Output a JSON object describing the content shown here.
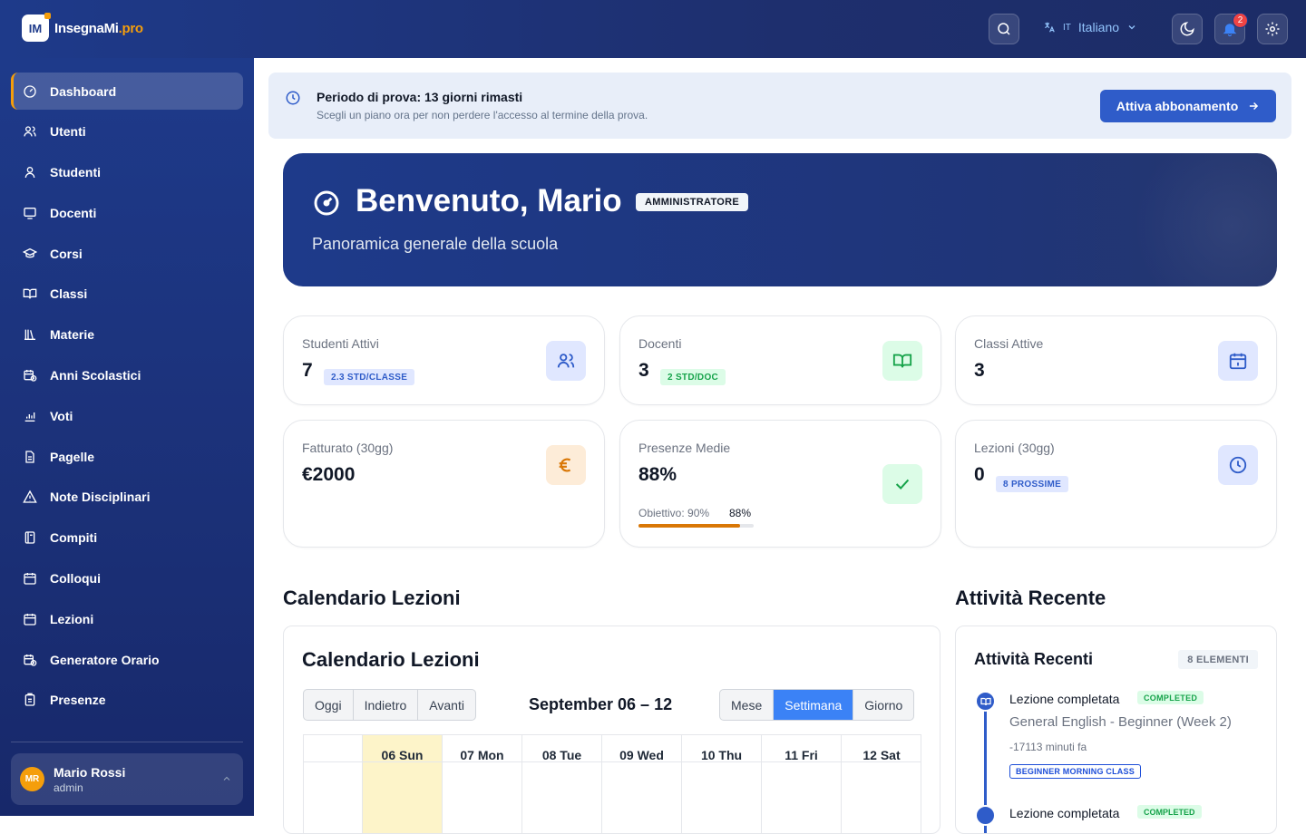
{
  "brand": {
    "name": "InsegnaMi",
    "suffix": ".pro",
    "mark": "IM"
  },
  "topbar": {
    "language_code": "IT",
    "language": "Italiano",
    "notifications": "2"
  },
  "sidebar": {
    "items": [
      {
        "label": "Dashboard",
        "icon": "gauge-icon"
      },
      {
        "label": "Utenti",
        "icon": "users-icon"
      },
      {
        "label": "Studenti",
        "icon": "user-icon"
      },
      {
        "label": "Docenti",
        "icon": "monitor-icon"
      },
      {
        "label": "Corsi",
        "icon": "graduation-cap-icon"
      },
      {
        "label": "Classi",
        "icon": "book-open-icon"
      },
      {
        "label": "Materie",
        "icon": "library-icon"
      },
      {
        "label": "Anni Scolastici",
        "icon": "calendar-clock-icon"
      },
      {
        "label": "Voti",
        "icon": "chart-icon"
      },
      {
        "label": "Pagelle",
        "icon": "file-icon"
      },
      {
        "label": "Note Disciplinari",
        "icon": "warning-icon"
      },
      {
        "label": "Compiti",
        "icon": "notebook-icon"
      },
      {
        "label": "Colloqui",
        "icon": "calendar-icon"
      },
      {
        "label": "Lezioni",
        "icon": "calendar-icon"
      },
      {
        "label": "Generatore Orario",
        "icon": "calendar-clock-icon"
      },
      {
        "label": "Presenze",
        "icon": "clipboard-icon"
      }
    ],
    "user": {
      "initials": "MR",
      "name": "Mario Rossi",
      "role": "admin"
    }
  },
  "trial": {
    "title": "Periodo di prova: 13 giorni rimasti",
    "subtitle": "Scegli un piano ora per non perdere l'accesso al termine della prova.",
    "button": "Attiva abbonamento"
  },
  "hero": {
    "title": "Benvenuto, Mario",
    "badge": "AMMINISTRATORE",
    "subtitle": "Panoramica generale della scuola"
  },
  "stats": [
    {
      "label": "Studenti Attivi",
      "value": "7",
      "badge": "2.3 STD/CLASSE"
    },
    {
      "label": "Docenti",
      "value": "3",
      "badge": "2 STD/DOC"
    },
    {
      "label": "Classi Attive",
      "value": "3"
    },
    {
      "label": "Fatturato (30gg)",
      "value": "€2000"
    },
    {
      "label": "Presenze Medie",
      "value": "88%",
      "progress_label": "Obiettivo: 90%",
      "progress_value": "88%",
      "progress_fraction": 0.88
    },
    {
      "label": "Lezioni (30gg)",
      "value": "0",
      "badge": "8 PROSSIME"
    }
  ],
  "calendar": {
    "section_title": "Calendario Lezioni",
    "title": "Calendario Lezioni",
    "nav": [
      "Oggi",
      "Indietro",
      "Avanti"
    ],
    "range": "September 06 – 12",
    "views": [
      "Mese",
      "Settimana",
      "Giorno"
    ],
    "active_view": "Settimana",
    "days": [
      "06 Sun",
      "07 Mon",
      "08 Tue",
      "09 Wed",
      "10 Thu",
      "11 Fri",
      "12 Sat"
    ]
  },
  "activity": {
    "section_title": "Attività Recente",
    "title": "Attività Recenti",
    "count": "8 ELEMENTI",
    "items": [
      {
        "title": "Lezione completata",
        "status": "COMPLETED",
        "subtitle": "General English - Beginner (Week 2)",
        "time": "-17113 minuti fa",
        "tag": "BEGINNER MORNING CLASS"
      },
      {
        "title": "Lezione completata",
        "status": "COMPLETED"
      }
    ]
  },
  "colors": {
    "primary": "#1e3a8a",
    "accent": "#f59e0b",
    "button": "#2f5cc9",
    "success": "#16a34a"
  }
}
